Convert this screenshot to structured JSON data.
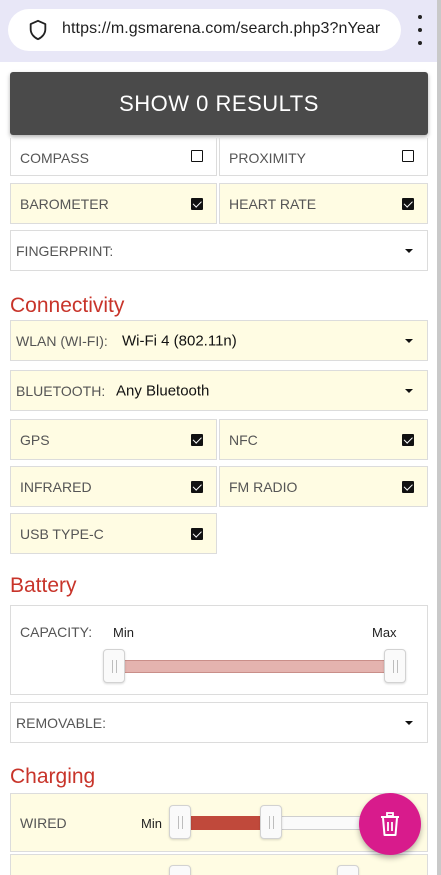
{
  "browser": {
    "url": "https://m.gsmarena.com/search.php3?nYear",
    "icons": {
      "security": "shield-icon",
      "menu": "more-vert-icon"
    }
  },
  "toolbar": {
    "show_results_label": "SHOW 0 RESULTS"
  },
  "sensors": {
    "compass": {
      "label": "COMPASS",
      "checked": false
    },
    "proximity": {
      "label": "PROXIMITY",
      "checked": false
    },
    "barometer": {
      "label": "BAROMETER",
      "checked": true
    },
    "heart_rate": {
      "label": "HEART RATE",
      "checked": true
    },
    "fingerprint": {
      "label": "FINGERPRINT:",
      "value": ""
    }
  },
  "connectivity": {
    "title": "Connectivity",
    "wlan": {
      "label": "WLAN (WI-FI):",
      "value": "Wi-Fi 4 (802.11n)"
    },
    "bluetooth": {
      "label": "BLUETOOTH:",
      "value": "Any Bluetooth"
    },
    "gps": {
      "label": "GPS",
      "checked": true
    },
    "nfc": {
      "label": "NFC",
      "checked": true
    },
    "infrared": {
      "label": "INFRARED",
      "checked": true
    },
    "fm_radio": {
      "label": "FM RADIO",
      "checked": true
    },
    "usb_type_c": {
      "label": "USB TYPE-C",
      "checked": true
    }
  },
  "battery": {
    "title": "Battery",
    "capacity": {
      "label": "CAPACITY:",
      "min_label": "Min",
      "max_label": "Max"
    },
    "removable": {
      "label": "REMOVABLE:",
      "value": ""
    }
  },
  "charging": {
    "title": "Charging",
    "wired": {
      "label": "WIRED",
      "min_label": "Min"
    }
  },
  "colors": {
    "accent_red": "#c8342a",
    "fab_pink": "#d81b8c",
    "highlight_yellow": "#fffce3",
    "button_dark": "#4a4a4a"
  },
  "fab": {
    "icon": "trash-icon"
  }
}
